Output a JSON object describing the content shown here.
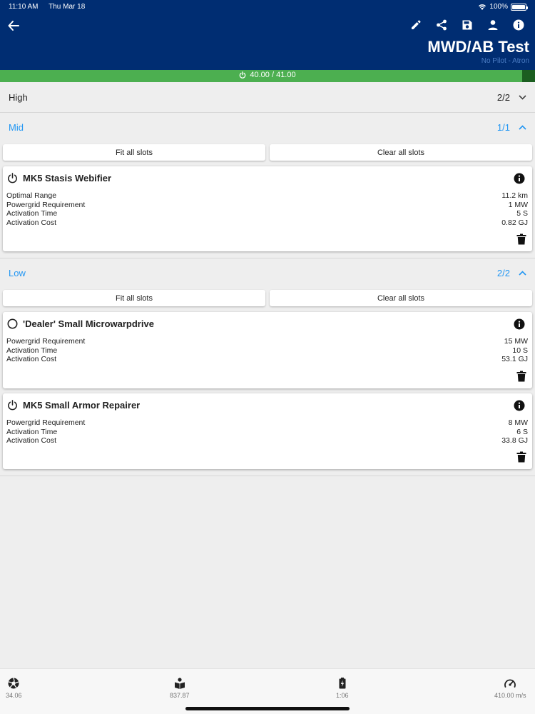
{
  "status_bar": {
    "time": "11:10 AM",
    "date": "Thu Mar 18",
    "battery": "100%"
  },
  "header": {
    "title": "MWD/AB Test",
    "subtitle": "No Pilot - Atron"
  },
  "capacitor": {
    "label": "40.00 / 41.00",
    "fraction": 0.976
  },
  "sections": {
    "high": {
      "name": "High",
      "count": "2/2"
    },
    "mid": {
      "name": "Mid",
      "count": "1/1",
      "fit_all": "Fit all slots",
      "clear_all": "Clear all slots"
    },
    "low": {
      "name": "Low",
      "count": "2/2",
      "fit_all": "Fit all slots",
      "clear_all": "Clear all slots"
    }
  },
  "modules": [
    {
      "title": "MK5 Stasis Webifier",
      "state_icon": "power-icon",
      "stats": [
        {
          "label": "Optimal Range",
          "value": "11.2 km"
        },
        {
          "label": "Powergrid Requirement",
          "value": "1 MW"
        },
        {
          "label": "Activation Time",
          "value": "5 S"
        },
        {
          "label": "Activation Cost",
          "value": "0.82 GJ"
        }
      ]
    },
    {
      "title": "'Dealer' Small Microwarpdrive",
      "state_icon": "circle-icon",
      "stats": [
        {
          "label": "Powergrid Requirement",
          "value": "15 MW"
        },
        {
          "label": "Activation Time",
          "value": "10 S"
        },
        {
          "label": "Activation Cost",
          "value": "53.1 GJ"
        }
      ]
    },
    {
      "title": "MK5 Small Armor Repairer",
      "state_icon": "power-icon",
      "stats": [
        {
          "label": "Powergrid Requirement",
          "value": "8 MW"
        },
        {
          "label": "Activation Time",
          "value": "6 S"
        },
        {
          "label": "Activation Cost",
          "value": "33.8 GJ"
        }
      ]
    }
  ],
  "bottom_stats": [
    {
      "icon": "aperture-icon",
      "value": "34.06"
    },
    {
      "icon": "book-icon",
      "value": "837.87"
    },
    {
      "icon": "battery-charging-icon",
      "value": "1:06"
    },
    {
      "icon": "speedometer-icon",
      "value": "410.00 m/s"
    }
  ],
  "colors": {
    "header": "#002d72",
    "accent": "#2196f3",
    "capacitor": "#4caf50"
  }
}
